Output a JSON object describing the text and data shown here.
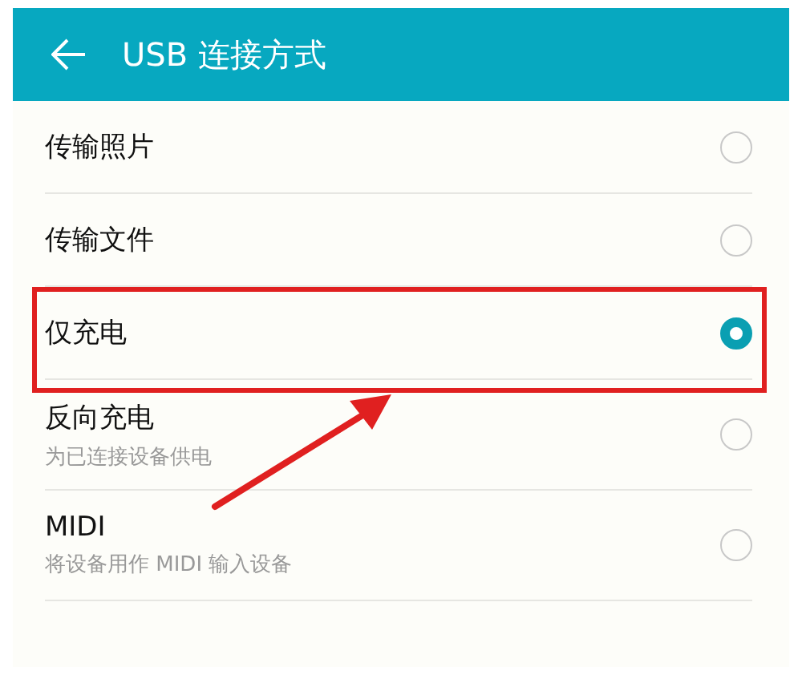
{
  "header": {
    "title": "USB 连接方式"
  },
  "options": [
    {
      "title": "传输照片",
      "selected": false,
      "highlighted": false
    },
    {
      "title": "传输文件",
      "selected": false,
      "highlighted": false
    },
    {
      "title": "仅充电",
      "selected": true,
      "highlighted": true
    },
    {
      "title": "反向充电",
      "subtitle": "为已连接设备供电",
      "selected": false,
      "highlighted": false
    },
    {
      "title": "MIDI",
      "subtitle": "将设备用作 MIDI 输入设备",
      "selected": false,
      "highlighted": false
    }
  ]
}
